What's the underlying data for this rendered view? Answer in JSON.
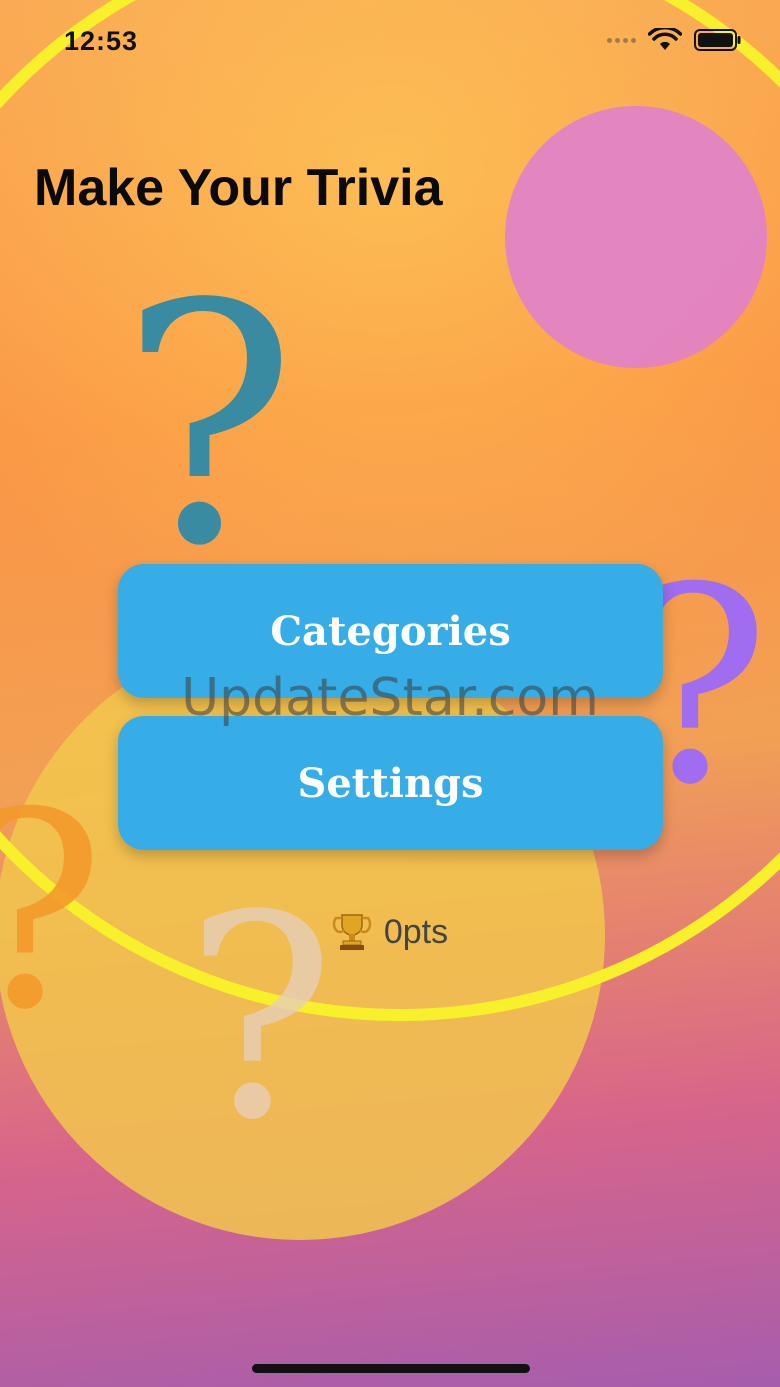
{
  "status_bar": {
    "time": "12:53",
    "signal_icon": "signal-dots-icon",
    "wifi_icon": "wifi-icon",
    "battery_icon": "battery-icon"
  },
  "header": {
    "title": "Make Your Trivia"
  },
  "menu": {
    "categories_label": "Categories",
    "settings_label": "Settings"
  },
  "watermark": "UpdateStar.com",
  "score": {
    "icon": "trophy-icon",
    "text": "0pts"
  },
  "colors": {
    "button": "#36ade6",
    "ring": "#f7ee2a",
    "pink_circle": "#e283c4",
    "teal_question": "#2e8aa6",
    "purple_question": "#a06cf0"
  }
}
